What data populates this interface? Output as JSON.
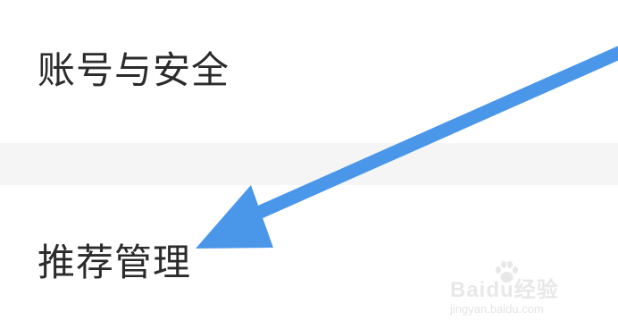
{
  "settings": {
    "items": [
      {
        "label": "账号与安全"
      },
      {
        "label": "推荐管理"
      }
    ]
  },
  "annotation": {
    "arrow_color": "#4a97ea",
    "points_to": "推荐管理"
  },
  "colors": {
    "background": "#ffffff",
    "divider": "#f5f5f5",
    "text": "#2b2b2b"
  },
  "watermark": {
    "logo_text": "Baidu经验",
    "url": "jingyan.baidu.com"
  }
}
